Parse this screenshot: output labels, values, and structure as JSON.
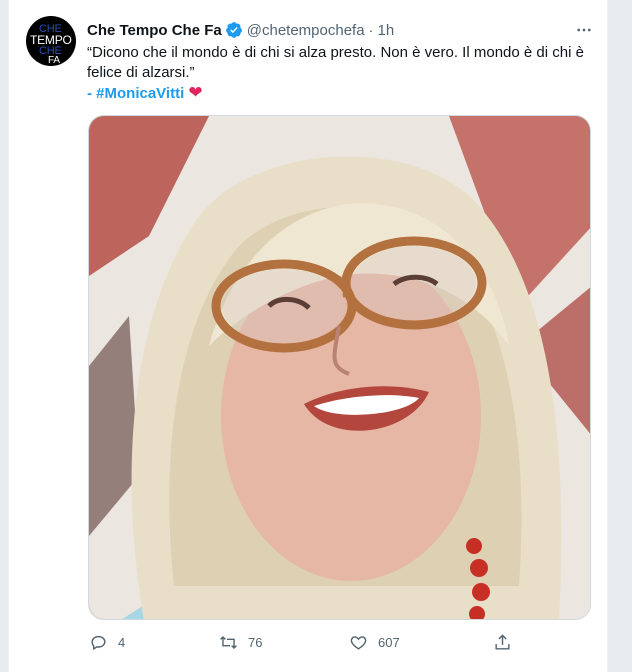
{
  "tweet": {
    "avatar_lines": [
      "CHE",
      "TEMPO",
      "CHE",
      "FA"
    ],
    "display_name": "Che Tempo Che Fa",
    "handle": "@chetempochefa",
    "separator": "·",
    "time": "1h",
    "text_line": "“Dicono che il mondo è di chi si alza presto. Non è vero. Il mondo è di chi è felice di alzarsi.”",
    "dash": "- ",
    "hashtag": "#MonicaVitti",
    "emoji": "❤",
    "colors": {
      "link": "#1d9bf0",
      "verified": "#1d9bf0",
      "heart": "#e0245e",
      "muted": "#536471"
    }
  },
  "actions": {
    "replies": "4",
    "retweets": "76",
    "likes": "607"
  },
  "icons": [
    "verified-badge-icon",
    "more-options-icon",
    "reply-icon",
    "retweet-icon",
    "like-icon",
    "share-icon"
  ]
}
